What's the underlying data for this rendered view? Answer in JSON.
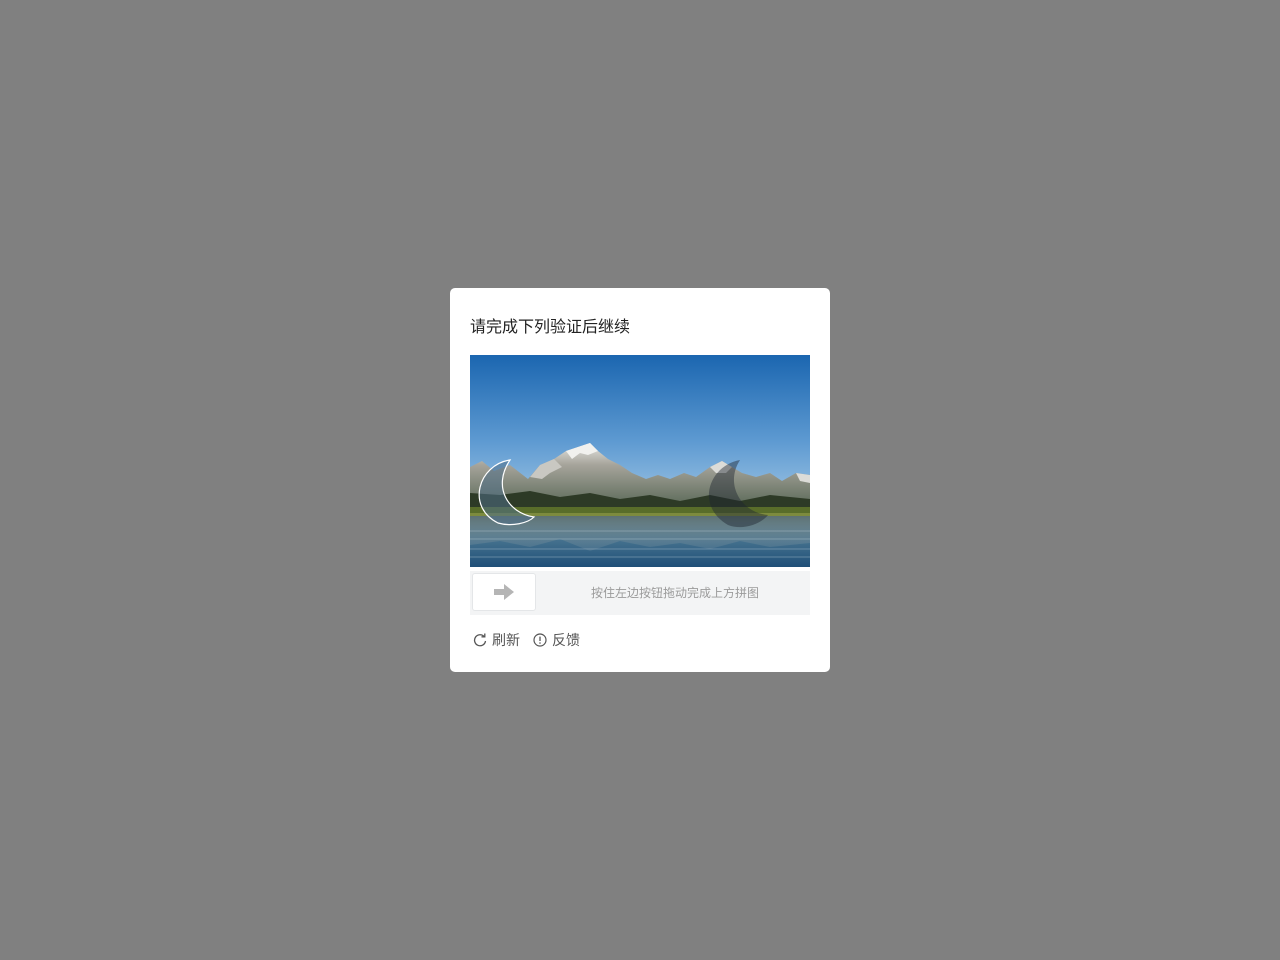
{
  "dialog": {
    "title": "请完成下列验证后继续"
  },
  "slider": {
    "hint": "按住左边按钮拖动完成上方拼图",
    "handle_icon": "arrow-right-icon",
    "progress": 0
  },
  "actions": {
    "refresh": {
      "label": "刷新",
      "icon": "refresh-icon"
    },
    "feedback": {
      "label": "反馈",
      "icon": "info-icon"
    }
  },
  "colors": {
    "overlay": "#808080",
    "dialog_bg": "#ffffff",
    "track_bg": "#f3f4f5",
    "hint_text": "#9b9b9b"
  }
}
